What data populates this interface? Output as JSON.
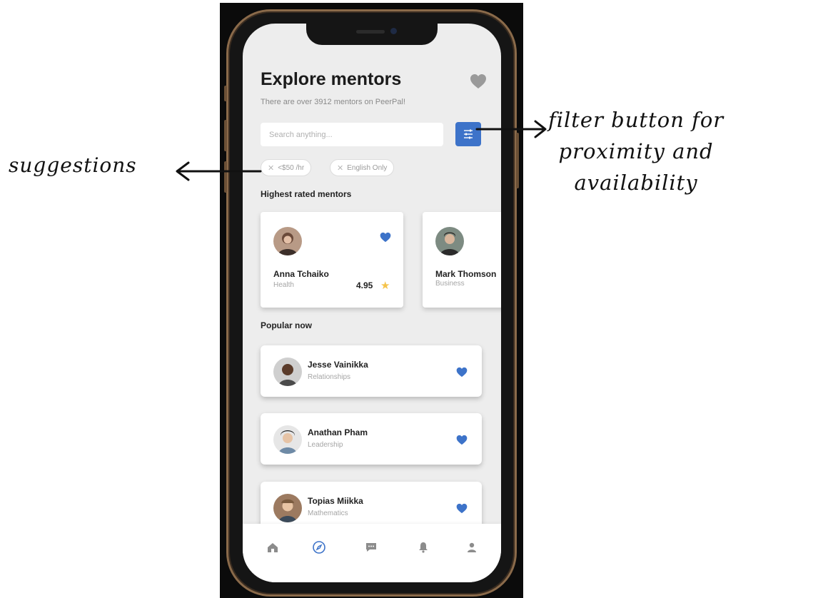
{
  "header": {
    "title": "Explore mentors",
    "subtitle": "There are over 3912 mentors on PeerPal!"
  },
  "search": {
    "placeholder": "Search anything...",
    "value": ""
  },
  "suggestions": [
    {
      "label": "<$50 /hr"
    },
    {
      "label": "English Only"
    }
  ],
  "highest_rated": {
    "title": "Highest rated mentors",
    "mentors": [
      {
        "name": "Anna Tchaiko",
        "category": "Health",
        "rating": "4.95"
      },
      {
        "name": "Mark Thomson",
        "category": "Business"
      }
    ]
  },
  "popular": {
    "title": "Popular now",
    "mentors": [
      {
        "name": "Jesse Vainikka",
        "category": "Relationships"
      },
      {
        "name": "Anathan Pham",
        "category": "Leadership"
      },
      {
        "name": "Topias Miikka",
        "category": "Mathematics"
      }
    ]
  },
  "tabbar": {
    "items": [
      {
        "icon": "home-icon"
      },
      {
        "icon": "compass-icon",
        "active": true
      },
      {
        "icon": "chat-icon"
      },
      {
        "icon": "bell-icon"
      },
      {
        "icon": "profile-icon"
      }
    ]
  },
  "annotations": {
    "left": "suggestions",
    "right": [
      "filter button for",
      "proximity and",
      "availability"
    ]
  },
  "colors": {
    "accent": "#3d73c9",
    "heart_top": "#9a9a9a",
    "star": "#f5c34a",
    "background": "#ededed"
  }
}
